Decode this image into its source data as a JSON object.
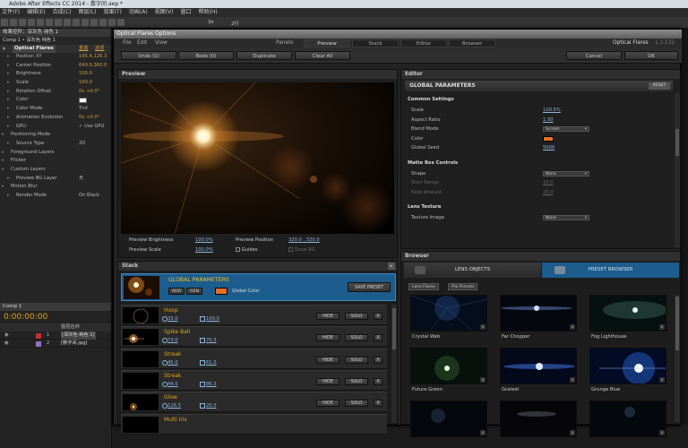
{
  "app": {
    "title": "Adobe After Effects CC 2014 - 散字间.aep *",
    "menu": [
      "文件(F)",
      "编辑(E)",
      "合成(C)",
      "图层(L)",
      "效果(T)",
      "动画(A)",
      "视图(V)",
      "窗口",
      "帮助(H)"
    ],
    "toolbar_labels": [
      "3x",
      "2行"
    ]
  },
  "effect_controls": {
    "tab": "效果控件：深灰色 纯色 1",
    "comp_line": "Comp 1 • 深灰色 纯色 1",
    "effect_name": "Optical Flares",
    "header_links": [
      "重置",
      "选项"
    ],
    "rows": [
      {
        "name": "Position XY",
        "value": "195.4,126.3"
      },
      {
        "name": "Center Position",
        "value": "640.0,360.0"
      },
      {
        "name": "Brightness",
        "value": "100.0"
      },
      {
        "name": "Scale",
        "value": "100.0"
      },
      {
        "name": "Rotation Offset",
        "value": "0x +0.0°"
      },
      {
        "name": "Color",
        "value": ""
      },
      {
        "name": "Color Mode",
        "value": "Tint"
      },
      {
        "name": "Animation Evolution",
        "value": "0x +0.0°"
      },
      {
        "name": "GPU",
        "value": "✓ Use GPU"
      },
      {
        "name": "Positioning Mode",
        "value": ""
      },
      {
        "name": "Source Type",
        "value": "2D"
      },
      {
        "name": "Foreground Layers",
        "value": ""
      },
      {
        "name": "Flicker",
        "value": ""
      },
      {
        "name": "Custom Layers",
        "value": ""
      },
      {
        "name": "Preview BG Layer",
        "value": "无"
      },
      {
        "name": "Motion Blur",
        "value": ""
      },
      {
        "name": "Render Mode",
        "value": "On Black"
      }
    ]
  },
  "timeline": {
    "tab": "Comp 1",
    "time": "0:00:00:00",
    "column_header": "图层名称",
    "layers": [
      {
        "num": "1",
        "name": "[深灰色 纯色 1]"
      },
      {
        "num": "2",
        "name": "[散字间.jpg]"
      }
    ]
  },
  "dialog": {
    "title": "Optical Flares Options",
    "menu": [
      "File",
      "Edit",
      "View"
    ],
    "panels_label": "Panels:",
    "panel_tabs": [
      "Preview",
      "Stack",
      "Editor",
      "Browser"
    ],
    "brand": "Optical Flares",
    "version": "1.3.132",
    "buttons": {
      "undo": "Undo (1)",
      "redo": "Redo (0)",
      "duplicate": "Duplicate",
      "clear": "Clear All",
      "cancel": "Cancel",
      "ok": "OK"
    },
    "preview": {
      "title": "Preview",
      "brightness_label": "Preview Brightness",
      "brightness_value": "100.0%",
      "scale_label": "Preview Scale",
      "scale_value": "100.0%",
      "position_label": "Preview Position",
      "position_value": "320.0 , 320.0",
      "guides_label": "Guides",
      "showbg_label": "Show BG"
    },
    "editor": {
      "title": "Editor",
      "section_title": "GLOBAL PARAMETERS",
      "reset": "RESET",
      "rows": [
        {
          "key": "Common Settings",
          "type": "header"
        },
        {
          "key": "Scale",
          "value": "120.5%"
        },
        {
          "key": "Aspect Ratio",
          "value": "1.00"
        },
        {
          "key": "Blend Mode",
          "select": "Screen"
        },
        {
          "key": "Color",
          "type": "color"
        },
        {
          "key": "Global Seed",
          "value": "5000"
        },
        {
          "key": "Matte Box Controls",
          "type": "header"
        },
        {
          "key": "Shape",
          "select": "None"
        },
        {
          "key": "Start Range",
          "value": "20.0",
          "dim": true
        },
        {
          "key": "Fade Amount",
          "value": "20.0",
          "dim": true
        },
        {
          "key": "Lens Texture",
          "type": "header"
        },
        {
          "key": "Texture Image",
          "select": "None"
        }
      ],
      "color_swatch": "#e0702a"
    },
    "stack": {
      "title": "Stack",
      "global_name": "GLOBAL PARAMETERS",
      "add": "ADD",
      "gen": "GEN",
      "global_color": "Global Color",
      "save_preset": "SAVE PRESET",
      "hide": "HIDE",
      "solo": "SOLO",
      "x": "X",
      "items": [
        {
          "name": "Hoop",
          "a": "33.0",
          "b": "100.0"
        },
        {
          "name": "Spike Ball",
          "a": "73.0",
          "b": "70.3"
        },
        {
          "name": "Streak",
          "a": "45.0",
          "b": "61.0"
        },
        {
          "name": "Streak",
          "a": "44.5",
          "b": "86.3"
        },
        {
          "name": "Glow",
          "a": "126.3",
          "b": "20.0"
        },
        {
          "name": "Multi Iris",
          "a": "",
          "b": ""
        }
      ]
    },
    "browser": {
      "title": "Browser",
      "tab_lens": "LENS OBJECTS",
      "tab_preset": "PRESET BROWSER",
      "crumbs": [
        "Lens Flares",
        "Pro Presets"
      ],
      "tiles": [
        "Crystal Web",
        "Far Chopper",
        "Fog Lighthouse",
        "Future Green",
        "Gratest",
        "Grunge Blue",
        "",
        "",
        ""
      ]
    }
  },
  "colors": {
    "accent": "#1c5d8e",
    "orange": "#e3a21a",
    "link": "#8fb8e0"
  }
}
